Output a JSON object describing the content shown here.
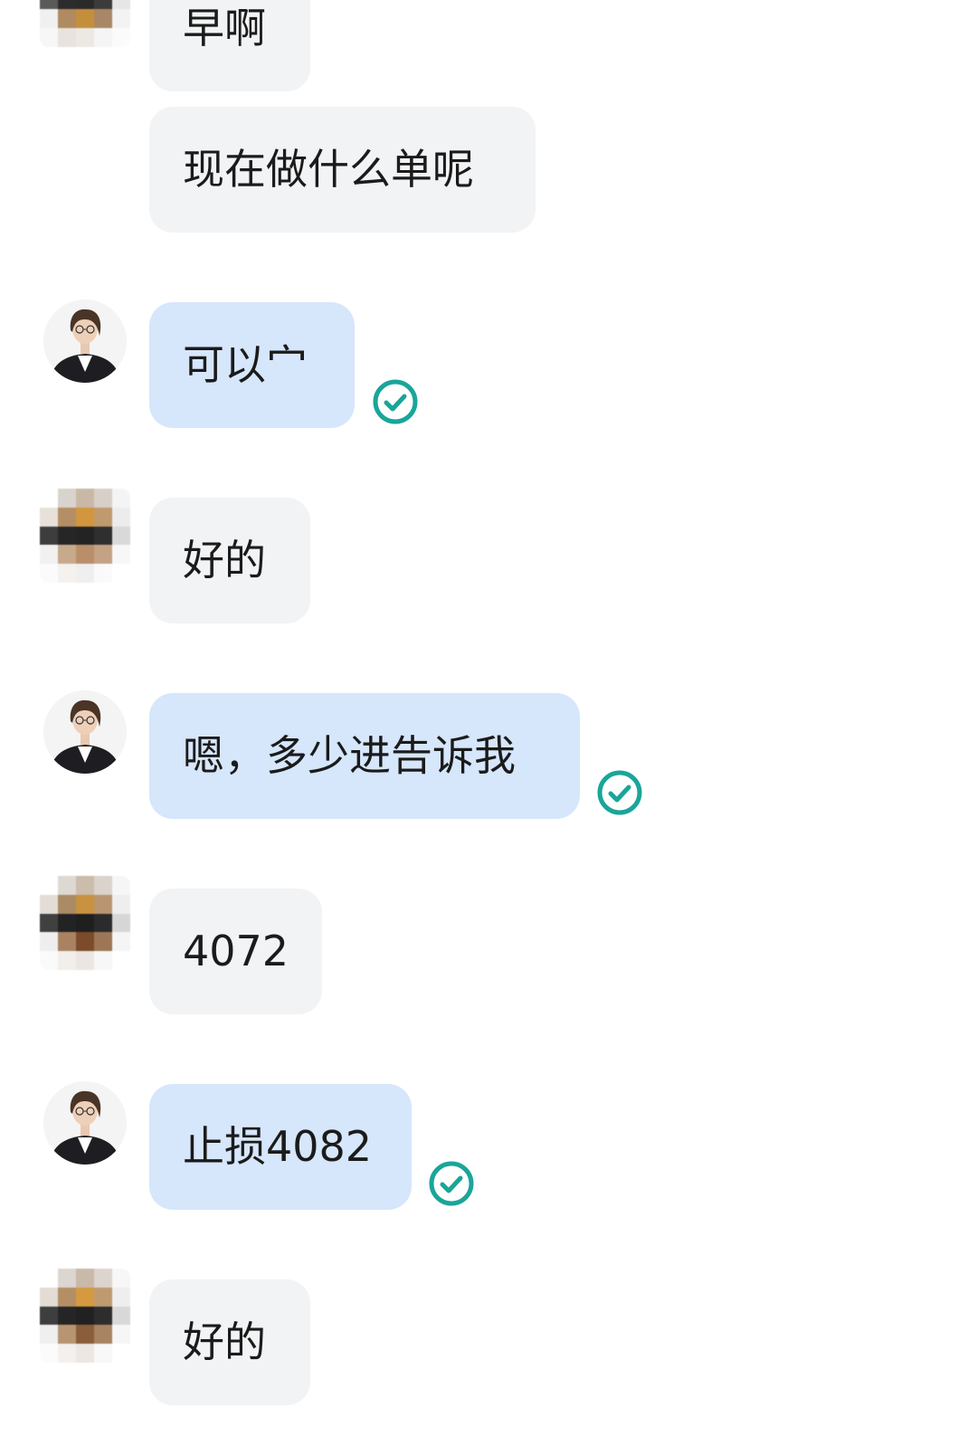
{
  "messages": [
    {
      "id": "m1",
      "side": "in",
      "text": "早啊",
      "read_receipt": false
    },
    {
      "id": "m2",
      "side": "in",
      "text": "现在做什么单呢",
      "read_receipt": false
    },
    {
      "id": "m3",
      "side": "out",
      "text": "可以宀",
      "read_receipt": true
    },
    {
      "id": "m4",
      "side": "in",
      "text": "好的",
      "read_receipt": false
    },
    {
      "id": "m5",
      "side": "out",
      "text": "嗯，多少进告诉我",
      "read_receipt": true
    },
    {
      "id": "m6",
      "side": "in",
      "text": "4072",
      "read_receipt": false
    },
    {
      "id": "m7",
      "side": "out",
      "text": "止损4082",
      "read_receipt": true
    },
    {
      "id": "m8",
      "side": "in",
      "text": "好的",
      "read_receipt": false
    }
  ],
  "icons": {
    "read_receipt": "check-circle-icon",
    "self_avatar": "avatar-woman-in-suit",
    "peer_avatar": "avatar-pixelated"
  },
  "colors": {
    "incoming_bubble": "#f2f3f5",
    "outgoing_bubble": "#d6e6fb",
    "check_teal": "#1aa59a",
    "text": "#1b1b1b"
  }
}
